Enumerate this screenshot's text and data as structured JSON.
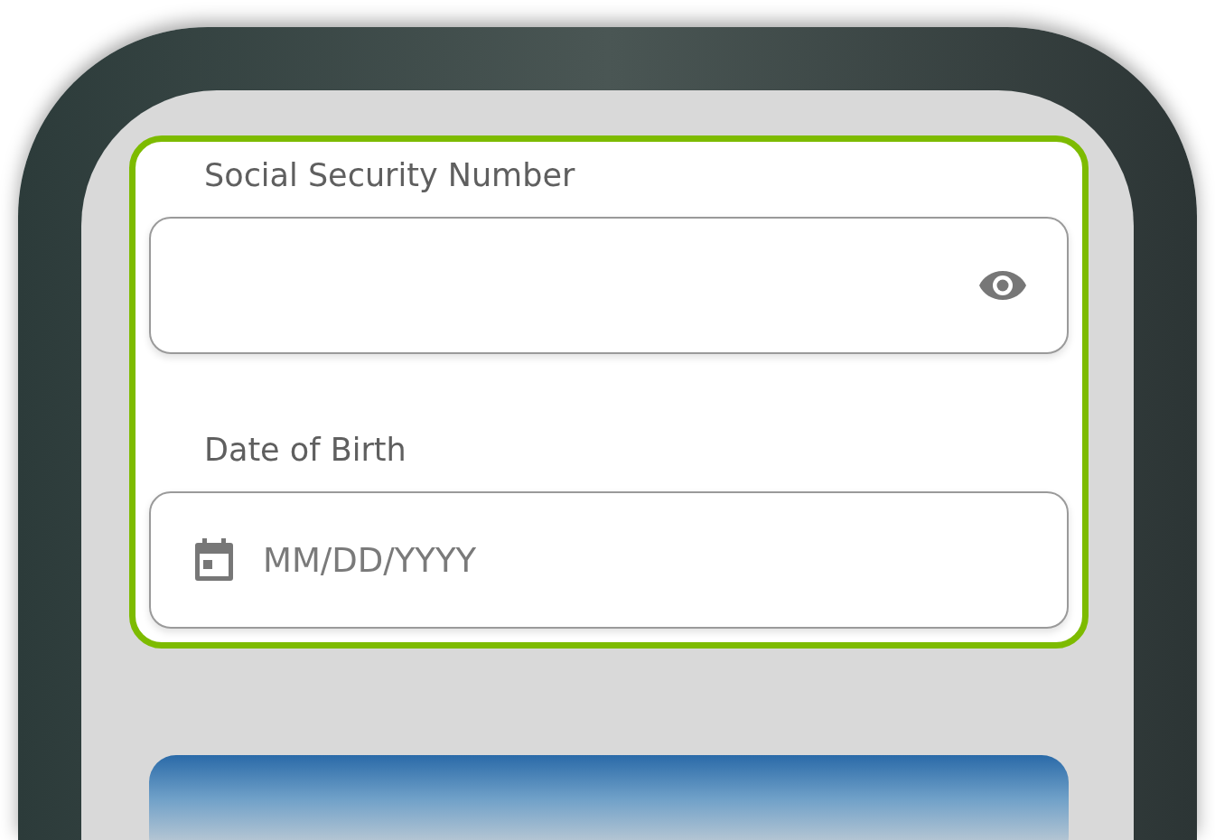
{
  "form_card": {
    "highlighted": true,
    "fields": [
      {
        "kind": "secret",
        "label": "Social Security Number"
      },
      {
        "kind": "date",
        "label": "Date of Birth",
        "placeholder": "MM/DD/YYYY"
      }
    ]
  }
}
